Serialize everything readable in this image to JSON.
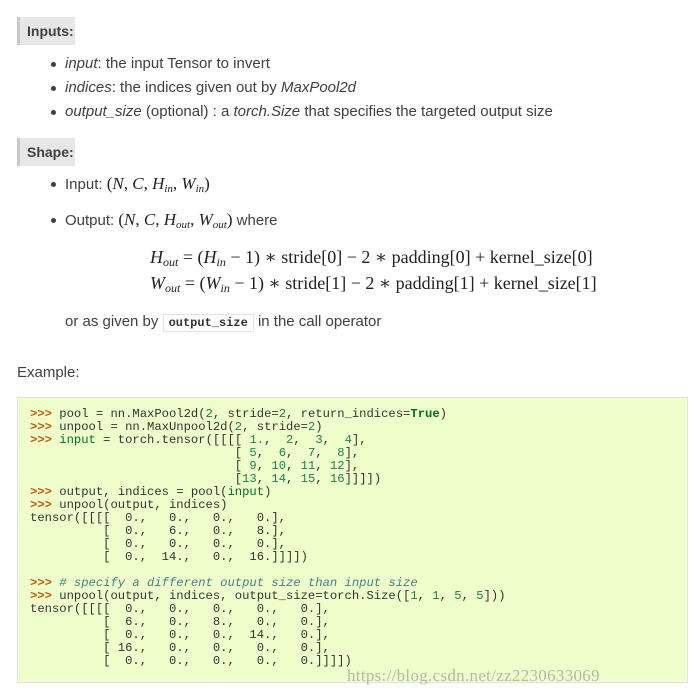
{
  "inputs": {
    "heading": "Inputs:",
    "items": [
      {
        "name": "input",
        "desc": ": the input Tensor to invert"
      },
      {
        "name": "indices",
        "desc": ": the indices given out by ",
        "ref": "MaxPool2d"
      },
      {
        "name": "output_size",
        "desc": " (optional) : a ",
        "ref": "torch.Size",
        "desc2": " that specifies the targeted output size"
      }
    ]
  },
  "shape": {
    "heading": "Shape:",
    "input_label": "Input: ",
    "output_label": "Output: ",
    "output_suffix": " where",
    "note_prefix": "or as given by ",
    "note_code": "output_size",
    "note_suffix": " in the call operator"
  },
  "example": {
    "heading": "Example:"
  },
  "watermark": "https://blog.csdn.net/zz2230633069"
}
